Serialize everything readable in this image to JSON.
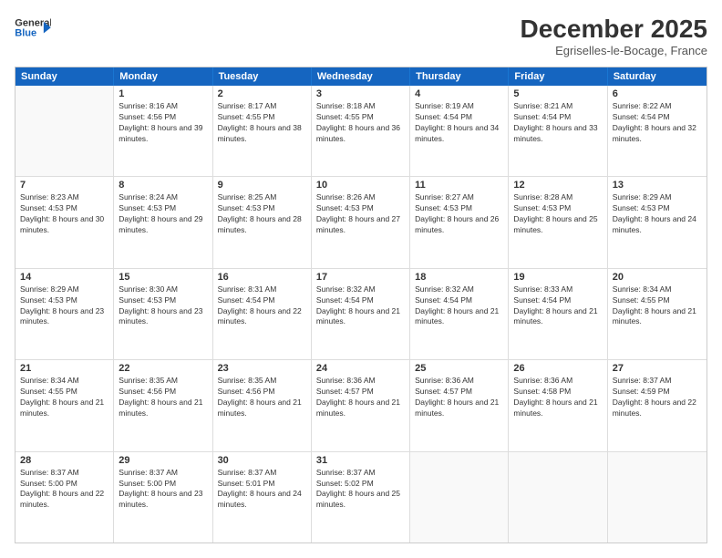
{
  "header": {
    "logo_line1": "General",
    "logo_line2": "Blue",
    "month": "December 2025",
    "location": "Egriselles-le-Bocage, France"
  },
  "weekdays": [
    "Sunday",
    "Monday",
    "Tuesday",
    "Wednesday",
    "Thursday",
    "Friday",
    "Saturday"
  ],
  "weeks": [
    [
      {
        "day": "",
        "sunrise": "",
        "sunset": "",
        "daylight": ""
      },
      {
        "day": "1",
        "sunrise": "Sunrise: 8:16 AM",
        "sunset": "Sunset: 4:56 PM",
        "daylight": "Daylight: 8 hours and 39 minutes."
      },
      {
        "day": "2",
        "sunrise": "Sunrise: 8:17 AM",
        "sunset": "Sunset: 4:55 PM",
        "daylight": "Daylight: 8 hours and 38 minutes."
      },
      {
        "day": "3",
        "sunrise": "Sunrise: 8:18 AM",
        "sunset": "Sunset: 4:55 PM",
        "daylight": "Daylight: 8 hours and 36 minutes."
      },
      {
        "day": "4",
        "sunrise": "Sunrise: 8:19 AM",
        "sunset": "Sunset: 4:54 PM",
        "daylight": "Daylight: 8 hours and 34 minutes."
      },
      {
        "day": "5",
        "sunrise": "Sunrise: 8:21 AM",
        "sunset": "Sunset: 4:54 PM",
        "daylight": "Daylight: 8 hours and 33 minutes."
      },
      {
        "day": "6",
        "sunrise": "Sunrise: 8:22 AM",
        "sunset": "Sunset: 4:54 PM",
        "daylight": "Daylight: 8 hours and 32 minutes."
      }
    ],
    [
      {
        "day": "7",
        "sunrise": "Sunrise: 8:23 AM",
        "sunset": "Sunset: 4:53 PM",
        "daylight": "Daylight: 8 hours and 30 minutes."
      },
      {
        "day": "8",
        "sunrise": "Sunrise: 8:24 AM",
        "sunset": "Sunset: 4:53 PM",
        "daylight": "Daylight: 8 hours and 29 minutes."
      },
      {
        "day": "9",
        "sunrise": "Sunrise: 8:25 AM",
        "sunset": "Sunset: 4:53 PM",
        "daylight": "Daylight: 8 hours and 28 minutes."
      },
      {
        "day": "10",
        "sunrise": "Sunrise: 8:26 AM",
        "sunset": "Sunset: 4:53 PM",
        "daylight": "Daylight: 8 hours and 27 minutes."
      },
      {
        "day": "11",
        "sunrise": "Sunrise: 8:27 AM",
        "sunset": "Sunset: 4:53 PM",
        "daylight": "Daylight: 8 hours and 26 minutes."
      },
      {
        "day": "12",
        "sunrise": "Sunrise: 8:28 AM",
        "sunset": "Sunset: 4:53 PM",
        "daylight": "Daylight: 8 hours and 25 minutes."
      },
      {
        "day": "13",
        "sunrise": "Sunrise: 8:29 AM",
        "sunset": "Sunset: 4:53 PM",
        "daylight": "Daylight: 8 hours and 24 minutes."
      }
    ],
    [
      {
        "day": "14",
        "sunrise": "Sunrise: 8:29 AM",
        "sunset": "Sunset: 4:53 PM",
        "daylight": "Daylight: 8 hours and 23 minutes."
      },
      {
        "day": "15",
        "sunrise": "Sunrise: 8:30 AM",
        "sunset": "Sunset: 4:53 PM",
        "daylight": "Daylight: 8 hours and 23 minutes."
      },
      {
        "day": "16",
        "sunrise": "Sunrise: 8:31 AM",
        "sunset": "Sunset: 4:54 PM",
        "daylight": "Daylight: 8 hours and 22 minutes."
      },
      {
        "day": "17",
        "sunrise": "Sunrise: 8:32 AM",
        "sunset": "Sunset: 4:54 PM",
        "daylight": "Daylight: 8 hours and 21 minutes."
      },
      {
        "day": "18",
        "sunrise": "Sunrise: 8:32 AM",
        "sunset": "Sunset: 4:54 PM",
        "daylight": "Daylight: 8 hours and 21 minutes."
      },
      {
        "day": "19",
        "sunrise": "Sunrise: 8:33 AM",
        "sunset": "Sunset: 4:54 PM",
        "daylight": "Daylight: 8 hours and 21 minutes."
      },
      {
        "day": "20",
        "sunrise": "Sunrise: 8:34 AM",
        "sunset": "Sunset: 4:55 PM",
        "daylight": "Daylight: 8 hours and 21 minutes."
      }
    ],
    [
      {
        "day": "21",
        "sunrise": "Sunrise: 8:34 AM",
        "sunset": "Sunset: 4:55 PM",
        "daylight": "Daylight: 8 hours and 21 minutes."
      },
      {
        "day": "22",
        "sunrise": "Sunrise: 8:35 AM",
        "sunset": "Sunset: 4:56 PM",
        "daylight": "Daylight: 8 hours and 21 minutes."
      },
      {
        "day": "23",
        "sunrise": "Sunrise: 8:35 AM",
        "sunset": "Sunset: 4:56 PM",
        "daylight": "Daylight: 8 hours and 21 minutes."
      },
      {
        "day": "24",
        "sunrise": "Sunrise: 8:36 AM",
        "sunset": "Sunset: 4:57 PM",
        "daylight": "Daylight: 8 hours and 21 minutes."
      },
      {
        "day": "25",
        "sunrise": "Sunrise: 8:36 AM",
        "sunset": "Sunset: 4:57 PM",
        "daylight": "Daylight: 8 hours and 21 minutes."
      },
      {
        "day": "26",
        "sunrise": "Sunrise: 8:36 AM",
        "sunset": "Sunset: 4:58 PM",
        "daylight": "Daylight: 8 hours and 21 minutes."
      },
      {
        "day": "27",
        "sunrise": "Sunrise: 8:37 AM",
        "sunset": "Sunset: 4:59 PM",
        "daylight": "Daylight: 8 hours and 22 minutes."
      }
    ],
    [
      {
        "day": "28",
        "sunrise": "Sunrise: 8:37 AM",
        "sunset": "Sunset: 5:00 PM",
        "daylight": "Daylight: 8 hours and 22 minutes."
      },
      {
        "day": "29",
        "sunrise": "Sunrise: 8:37 AM",
        "sunset": "Sunset: 5:00 PM",
        "daylight": "Daylight: 8 hours and 23 minutes."
      },
      {
        "day": "30",
        "sunrise": "Sunrise: 8:37 AM",
        "sunset": "Sunset: 5:01 PM",
        "daylight": "Daylight: 8 hours and 24 minutes."
      },
      {
        "day": "31",
        "sunrise": "Sunrise: 8:37 AM",
        "sunset": "Sunset: 5:02 PM",
        "daylight": "Daylight: 8 hours and 25 minutes."
      },
      {
        "day": "",
        "sunrise": "",
        "sunset": "",
        "daylight": ""
      },
      {
        "day": "",
        "sunrise": "",
        "sunset": "",
        "daylight": ""
      },
      {
        "day": "",
        "sunrise": "",
        "sunset": "",
        "daylight": ""
      }
    ]
  ]
}
